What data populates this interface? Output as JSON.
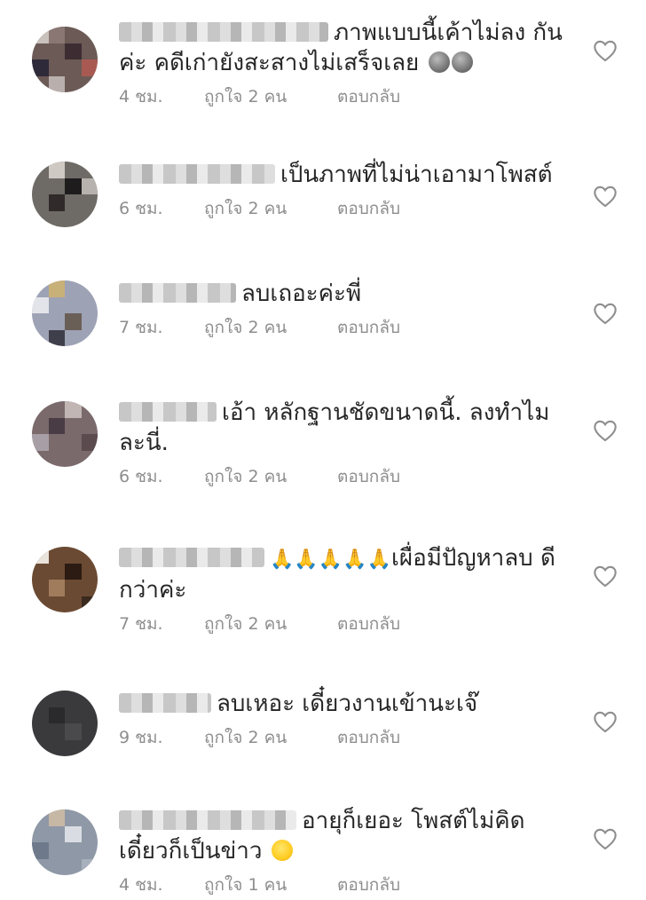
{
  "colors": {
    "text": "#262626",
    "meta": "#8e8e8e",
    "heart": "#8e8e8e"
  },
  "comments": [
    {
      "text": "ภาพแบบนี้เค้าไม่ลง กันค่ะ คดีเก่ายังสะสางไม่เสร็จเลย",
      "emoji": "moon-face moon-face",
      "time": "4 ชม.",
      "likes": "ถูกใจ 2 คน",
      "reply": "ตอบกลับ"
    },
    {
      "text": "เป็นภาพที่ไม่น่าเอามาโพสต์",
      "time": "6 ชม.",
      "likes": "ถูกใจ 2 คน",
      "reply": "ตอบกลับ"
    },
    {
      "text": "ลบเถอะค่ะพี่",
      "time": "7 ชม.",
      "likes": "ถูกใจ 2 คน",
      "reply": "ตอบกลับ"
    },
    {
      "text": "เอ้า หลักฐานชัดขนาดนี้. ลงทำไม ละนี่.",
      "time": "6 ชม.",
      "likes": "ถูกใจ 2 คน",
      "reply": "ตอบกลับ"
    },
    {
      "text": "เผื่อมีปัญหาลบ ดีกว่าค่ะ",
      "emoji": "folded-hands x5",
      "time": "7 ชม.",
      "likes": "ถูกใจ 2 คน",
      "reply": "ตอบกลับ"
    },
    {
      "text": "ลบเหอะ เดี๋ยวงานเข้านะเจ๊",
      "time": "9 ชม.",
      "likes": "ถูกใจ 2 คน",
      "reply": "ตอบกลับ"
    },
    {
      "text": "อายุก็เยอะ โพสต์ไม่คิด เดี๋ยวก็เป็นข่าว",
      "emoji": "grinning-face",
      "time": "4 ชม.",
      "likes": "ถูกใจ 1 คน",
      "reply": "ตอบกลับ"
    }
  ]
}
